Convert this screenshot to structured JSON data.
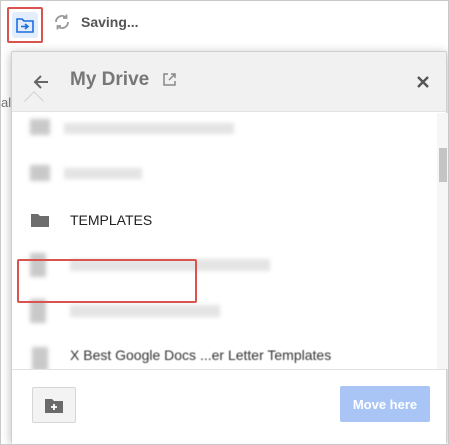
{
  "toolbar": {
    "status": "Saving...",
    "side_letter": "al"
  },
  "dialog": {
    "title": "My Drive",
    "items": [
      {
        "label": "TEMPLATES",
        "icon": "folder-icon"
      },
      {
        "label": "X Best Google Docs ...er Letter Templates",
        "icon": "doc-icon"
      }
    ],
    "move_here_label": "Move here"
  },
  "colors": {
    "highlight": "#d9534f",
    "accent_light": "#e3edfb",
    "button_disabled": "#a9c5f5"
  }
}
